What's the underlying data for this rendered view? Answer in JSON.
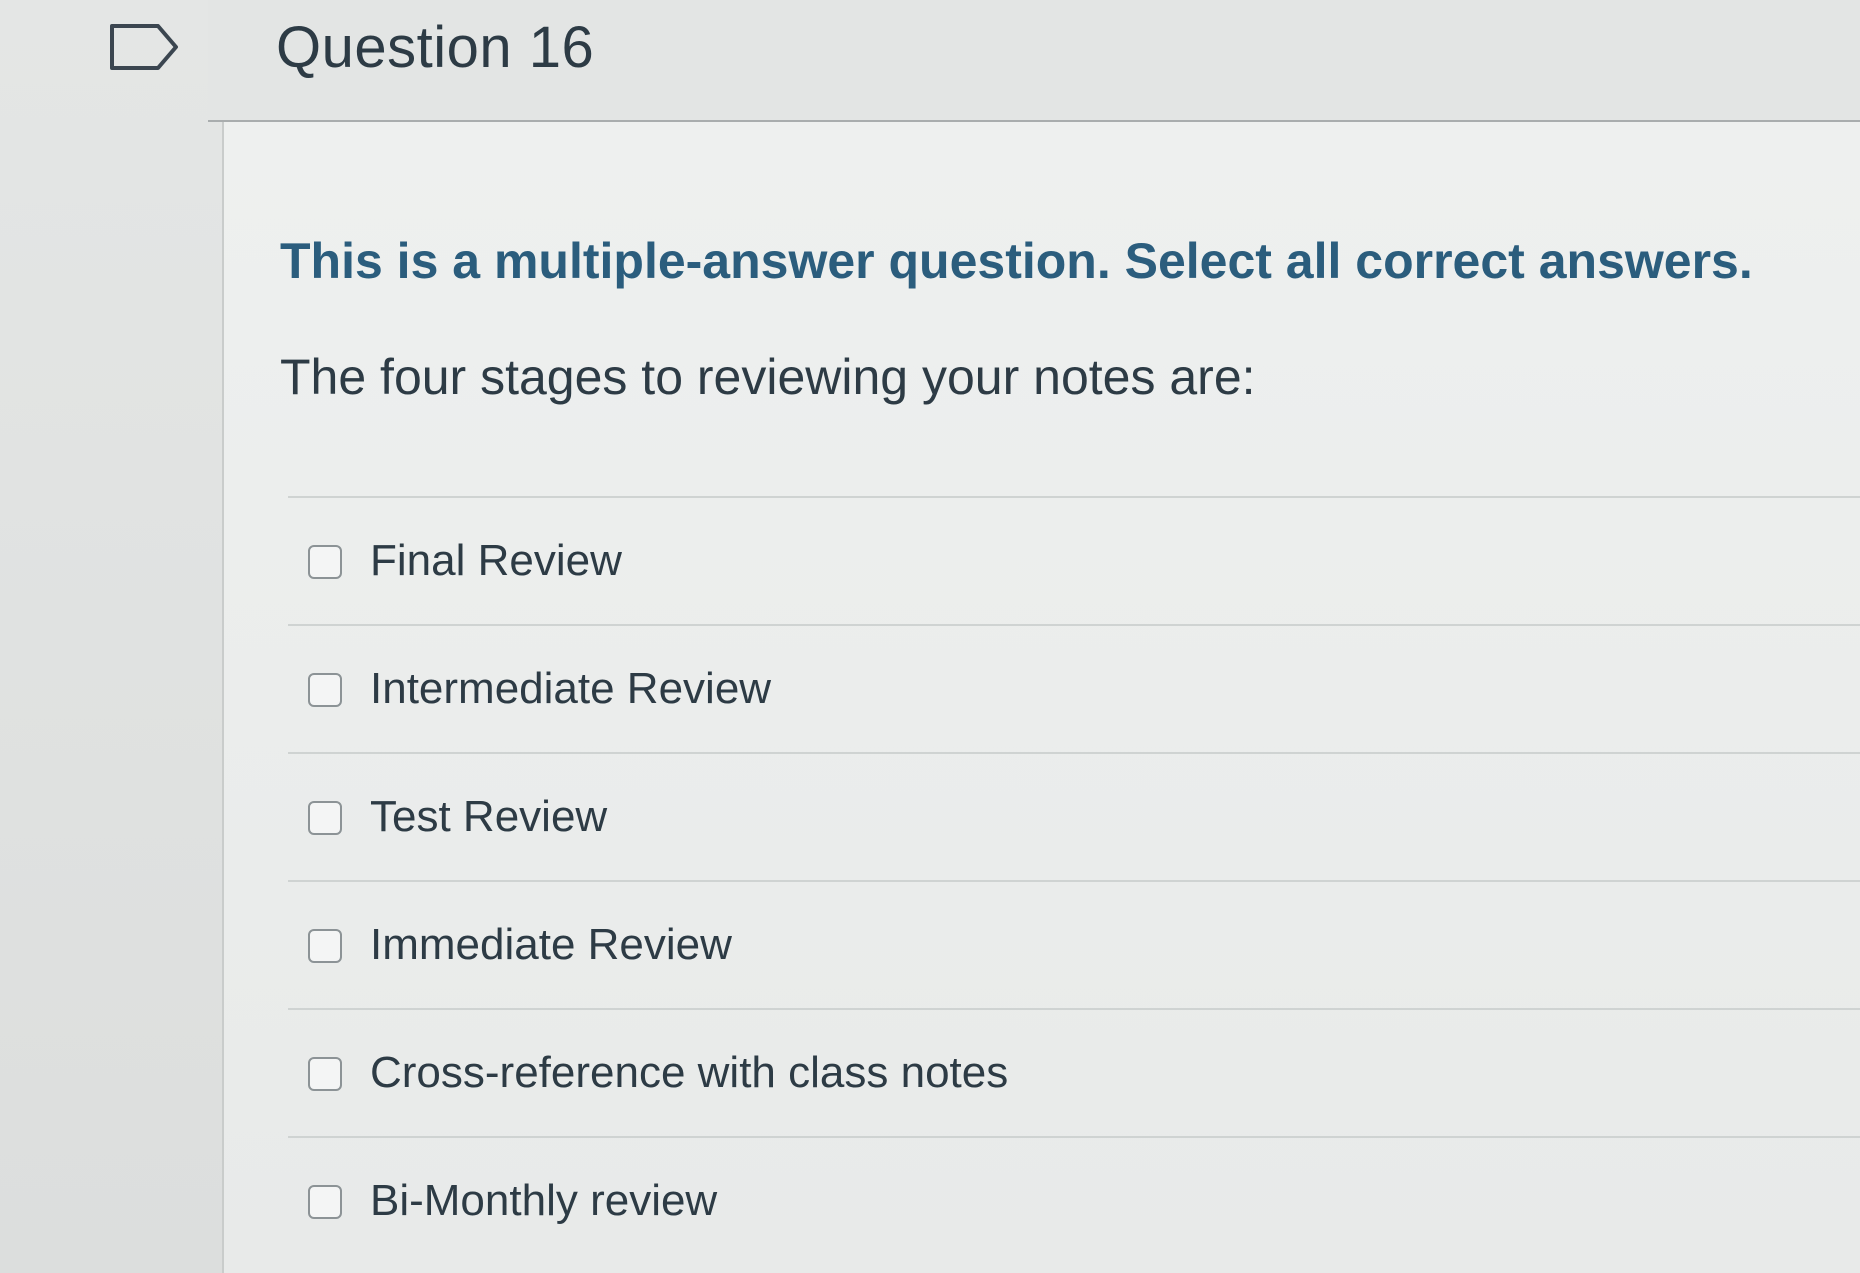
{
  "question": {
    "title": "Question 16",
    "instruction": "This is a multiple-answer question. Select all correct answers.",
    "prompt": "The four stages to reviewing your notes are:"
  },
  "answers": [
    {
      "label": "Final Review",
      "checked": false
    },
    {
      "label": "Intermediate Review",
      "checked": false
    },
    {
      "label": "Test Review",
      "checked": false
    },
    {
      "label": "Immediate Review",
      "checked": false
    },
    {
      "label": "Cross-reference with class notes",
      "checked": false
    },
    {
      "label": "Bi-Monthly review",
      "checked": false
    }
  ],
  "icons": {
    "flag": "flag-icon"
  },
  "colors": {
    "instruction": "#2b5d7d",
    "text": "#2d3b45"
  }
}
